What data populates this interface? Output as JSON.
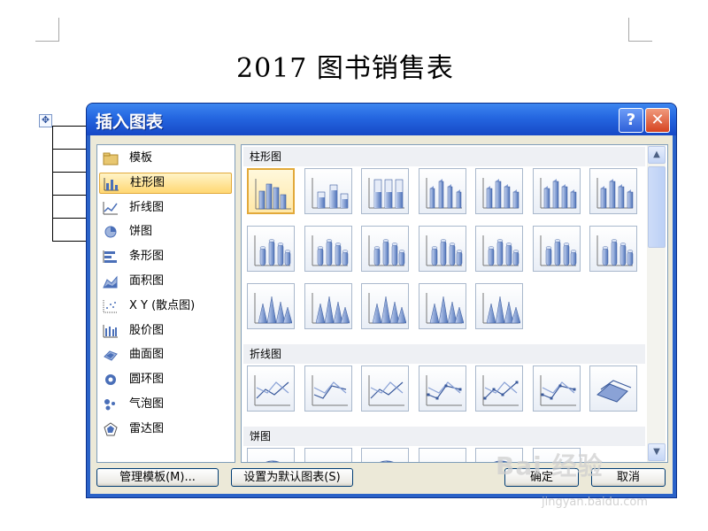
{
  "document": {
    "title": "2017 图书销售表",
    "table_handle_icon": "move-cross-icon"
  },
  "dialog": {
    "title": "插入图表",
    "help_label": "?",
    "close_label": "✕",
    "categories": [
      {
        "label": "模板",
        "icon": "folder-icon"
      },
      {
        "label": "柱形图",
        "icon": "column-chart-icon",
        "selected": true
      },
      {
        "label": "折线图",
        "icon": "line-chart-icon"
      },
      {
        "label": "饼图",
        "icon": "pie-chart-icon"
      },
      {
        "label": "条形图",
        "icon": "bar-chart-icon"
      },
      {
        "label": "面积图",
        "icon": "area-chart-icon"
      },
      {
        "label": "X Y (散点图)",
        "icon": "scatter-chart-icon"
      },
      {
        "label": "股价图",
        "icon": "stock-chart-icon"
      },
      {
        "label": "曲面图",
        "icon": "surface-chart-icon"
      },
      {
        "label": "圆环图",
        "icon": "doughnut-chart-icon"
      },
      {
        "label": "气泡图",
        "icon": "bubble-chart-icon"
      },
      {
        "label": "雷达图",
        "icon": "radar-chart-icon"
      }
    ],
    "gallery": {
      "sections": [
        {
          "label": "柱形图",
          "thumb_count": 19,
          "selected_index": 0
        },
        {
          "label": "折线图",
          "thumb_count": 7
        },
        {
          "label": "饼图",
          "thumb_count": 6
        }
      ]
    },
    "buttons": {
      "manage_templates": "管理模板(M)...",
      "set_default": "设置为默认图表(S)",
      "ok": "确定",
      "cancel": "取消"
    }
  },
  "watermark": {
    "text": "Bai 经验",
    "url": "jingyan.baidu.com"
  },
  "colors": {
    "titlebar": "#2466e0",
    "selection": "#ffd773",
    "chart_blue": "#5b7fc0"
  }
}
